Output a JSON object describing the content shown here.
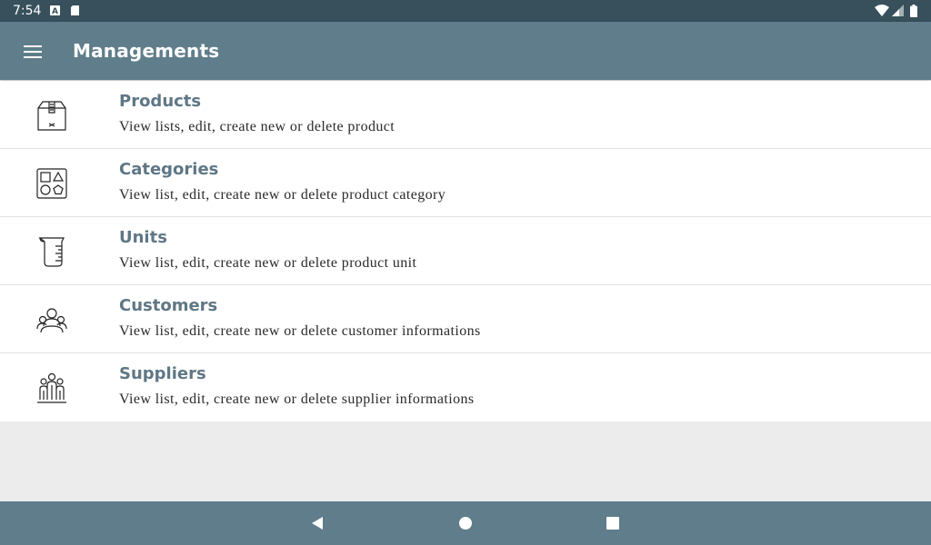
{
  "status_bar": {
    "time": "7:54",
    "left_icons": [
      "a-icon",
      "sd-card-icon"
    ],
    "right_icons": [
      "wifi-icon",
      "signal-icon",
      "battery-icon"
    ]
  },
  "app_bar": {
    "title": "Managements",
    "menu_icon": "hamburger-menu-icon",
    "color": "#607d8b"
  },
  "items": [
    {
      "icon": "box-icon",
      "title": "Products",
      "subtitle": "View lists, edit, create new or delete product"
    },
    {
      "icon": "shapes-icon",
      "title": "Categories",
      "subtitle": "View list, edit, create new or delete product category"
    },
    {
      "icon": "measuring-cup-icon",
      "title": "Units",
      "subtitle": "View list, edit, create new or delete product unit"
    },
    {
      "icon": "people-group-icon",
      "title": "Customers",
      "subtitle": "View list, edit, create new or delete customer informations"
    },
    {
      "icon": "team-icon",
      "title": "Suppliers",
      "subtitle": "View list, edit, create new or delete supplier informations"
    }
  ],
  "nav_bar": {
    "buttons": [
      "back-icon",
      "home-icon",
      "recents-icon"
    ],
    "color": "#607d8b"
  }
}
